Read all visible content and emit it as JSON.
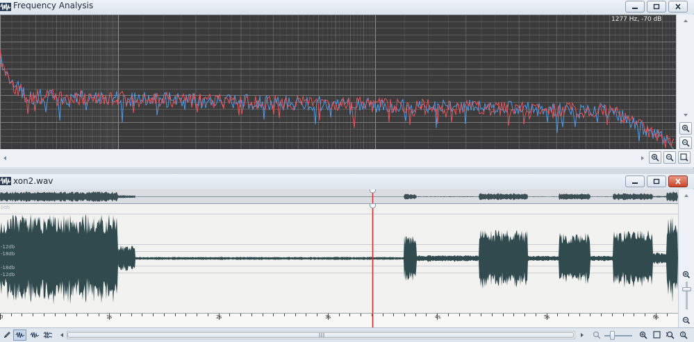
{
  "freq_window": {
    "title": "Frequency Analysis",
    "readout": "1277 Hz, -70 dB",
    "colors": {
      "background": "#3b3b3b",
      "grid": "#8c8c8c",
      "left_channel": "#e8555a",
      "right_channel": "#4f9be6"
    }
  },
  "wave_window": {
    "title": "xon2.wav",
    "db_labels": [
      "0db",
      "-12db",
      "-18db",
      "-18db",
      "-12db"
    ],
    "time_ticks": [
      "0",
      "1s",
      "2s",
      "3s",
      "4s",
      "5s",
      "6s"
    ],
    "colors": {
      "waveform": "#304a4d",
      "cursor": "#d42a2a",
      "background": "#f2f2f0"
    }
  },
  "icons": {
    "app": "waveform-icon",
    "minimize": "minimize-icon",
    "maximize": "maximize-icon",
    "close": "close-icon",
    "zoom_in": "zoom-in-icon",
    "zoom_out": "zoom-out-icon",
    "zoom_fit": "zoom-fit-icon",
    "pencil": "pencil-icon"
  }
}
